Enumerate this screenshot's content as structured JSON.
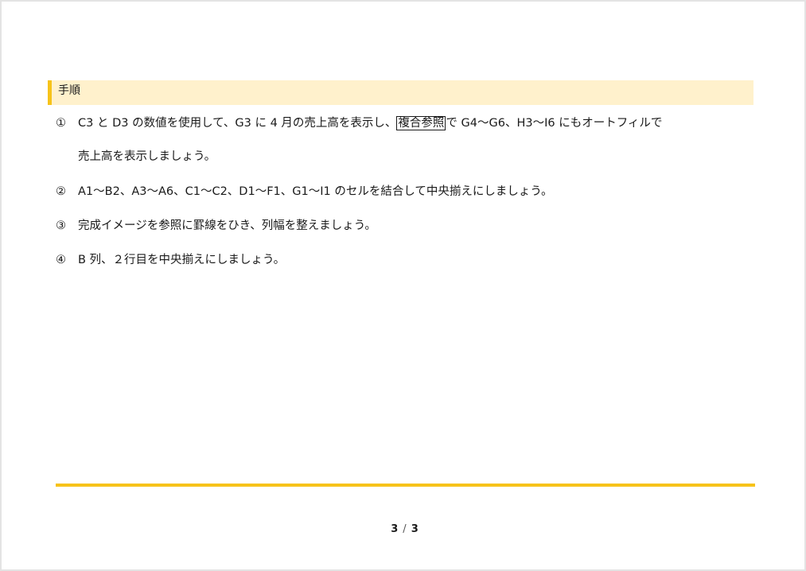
{
  "section": {
    "title": "手順"
  },
  "steps": [
    {
      "num": "①",
      "line1_before": "C3 と D3 の数値を使用して、G3 に 4 月の売上高を表示し、",
      "line1_boxed": "複合参照",
      "line1_after": "で G4～G6、H3～I6 にもオートフィルで",
      "line2": "売上高を表示しましょう。"
    },
    {
      "num": "②",
      "text": "A1～B2、A3～A6、C1～C2、D1～F1、G1～I1 のセルを結合して中央揃えにしましょう。"
    },
    {
      "num": "③",
      "text": "完成イメージを参照に罫線をひき、列幅を整えましょう。"
    },
    {
      "num": "④",
      "text": "B 列、２行目を中央揃えにしましょう。"
    }
  ],
  "footer": {
    "current_page": "3",
    "separator": "/",
    "total_pages": "3"
  },
  "colors": {
    "accent": "#f7c31a",
    "header_bg": "#fff1cc"
  }
}
